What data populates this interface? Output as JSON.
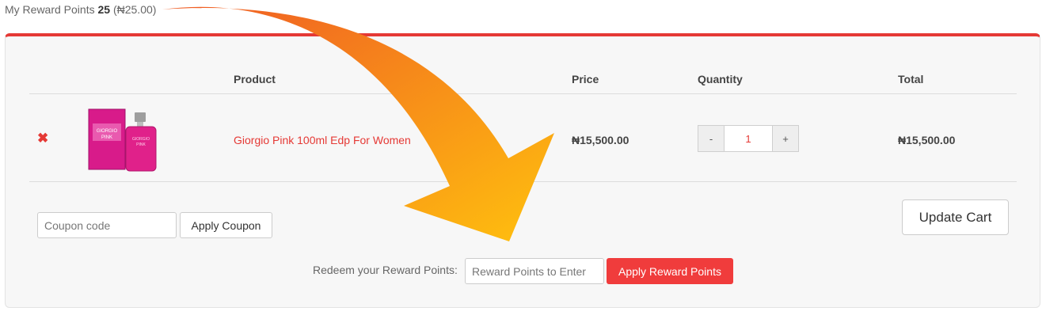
{
  "reward": {
    "prefix": "My Reward Points",
    "points": "25",
    "value": "(₦25.00)"
  },
  "table": {
    "headers": {
      "product": "Product",
      "price": "Price",
      "quantity": "Quantity",
      "total": "Total"
    },
    "row": {
      "product_name": "Giorgio Pink 100ml Edp For Women",
      "price": "₦15,500.00",
      "quantity": "1",
      "total": "₦15,500.00",
      "qty_minus": "-",
      "qty_plus": "+",
      "remove_glyph": "✖"
    }
  },
  "coupon": {
    "placeholder": "Coupon code",
    "apply_label": "Apply Coupon"
  },
  "update_cart_label": "Update Cart",
  "redeem": {
    "label": "Redeem your Reward Points:",
    "placeholder": "Reward Points to Enter",
    "apply_label": "Apply Reward Points"
  },
  "product_image": {
    "box_text_line1": "GIORGIO",
    "box_text_line2": "PINK",
    "bottle_text_line1": "GIORGIO",
    "bottle_text_line2": "PINK"
  },
  "colors": {
    "accent": "#e53935",
    "apply_points_bg": "#f03c3c",
    "arrow_start": "#ef5a24",
    "arrow_end": "#ffc10e"
  },
  "icons": {
    "remove": "remove-icon",
    "arrow": "curved-arrow-icon"
  }
}
